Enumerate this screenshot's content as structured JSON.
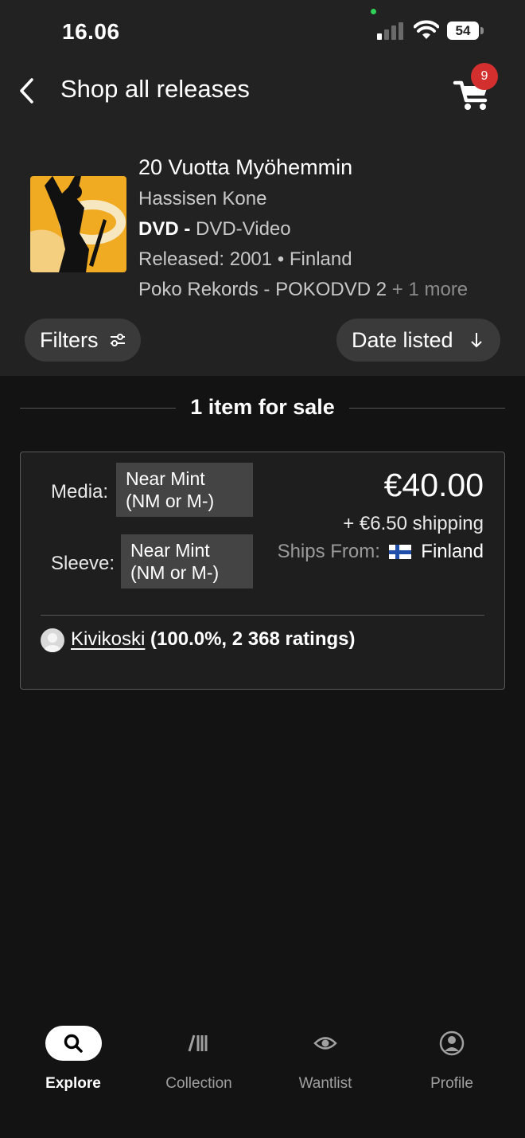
{
  "status_bar": {
    "time": "16.06",
    "battery": "54"
  },
  "header": {
    "title": "Shop all releases",
    "cart_count": "9"
  },
  "release": {
    "title": "20 Vuotta Myöhemmin",
    "artist": "Hassisen Kone",
    "format_bold": "DVD - ",
    "format_detail": "DVD-Video",
    "released": "Released: 2001 • Finland",
    "label": "Poko Rekords - POKODVD 2",
    "label_more": " + 1 more"
  },
  "controls": {
    "filters_label": "Filters",
    "sort_label": "Date listed"
  },
  "listings_header": {
    "count_text": "1 item for sale"
  },
  "listing": {
    "media_label": "Media:",
    "media_condition": "Near Mint (NM or M-)",
    "sleeve_label": "Sleeve:",
    "sleeve_condition": "Near Mint (NM or M-)",
    "price": "€40.00",
    "shipping": "+ €6.50 shipping",
    "ships_from_label": "Ships From:",
    "ships_from_country": "Finland",
    "seller_name": "Kivikoski",
    "seller_rating": " (100.0%, 2 368 ratings)"
  },
  "tabbar": {
    "tabs": [
      {
        "label": "Explore",
        "icon": "search-icon",
        "active": true
      },
      {
        "label": "Collection",
        "icon": "collection-icon",
        "active": false
      },
      {
        "label": "Wantlist",
        "icon": "eye-icon",
        "active": false
      },
      {
        "label": "Profile",
        "icon": "profile-icon",
        "active": false
      }
    ]
  },
  "colors": {
    "background": "#131313",
    "top_area": "#222222",
    "badge": "#d32f2f",
    "pill": "#3a3a3a"
  }
}
